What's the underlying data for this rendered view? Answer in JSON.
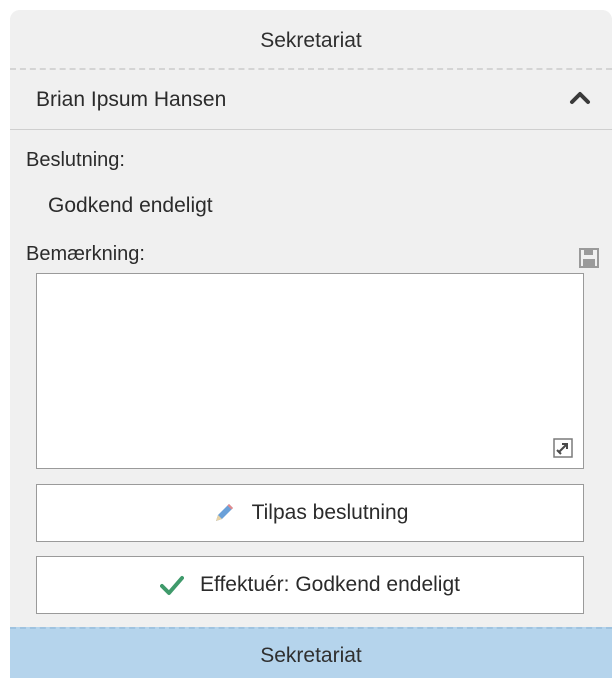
{
  "top_section": {
    "title": "Sekretariat"
  },
  "person": {
    "name": "Brian Ipsum Hansen"
  },
  "decision": {
    "label": "Beslutning:",
    "value": "Godkend endeligt"
  },
  "remark": {
    "label": "Bemærkning:",
    "value": ""
  },
  "buttons": {
    "adjust_label": "Tilpas beslutning",
    "effectuate_label": "Effektuér: Godkend endeligt"
  },
  "bottom_section": {
    "title": "Sekretariat"
  },
  "icons": {
    "collapse": "chevron-up-icon",
    "save": "save-icon",
    "expand": "expand-icon",
    "adjust": "pencil-icon",
    "effectuate": "checkmark-icon"
  },
  "colors": {
    "panel_bg": "#f0f0f0",
    "selected_section_bg": "#b5d4ec",
    "checkmark": "#3f9a6b",
    "pencil": "#6aa0d8"
  }
}
